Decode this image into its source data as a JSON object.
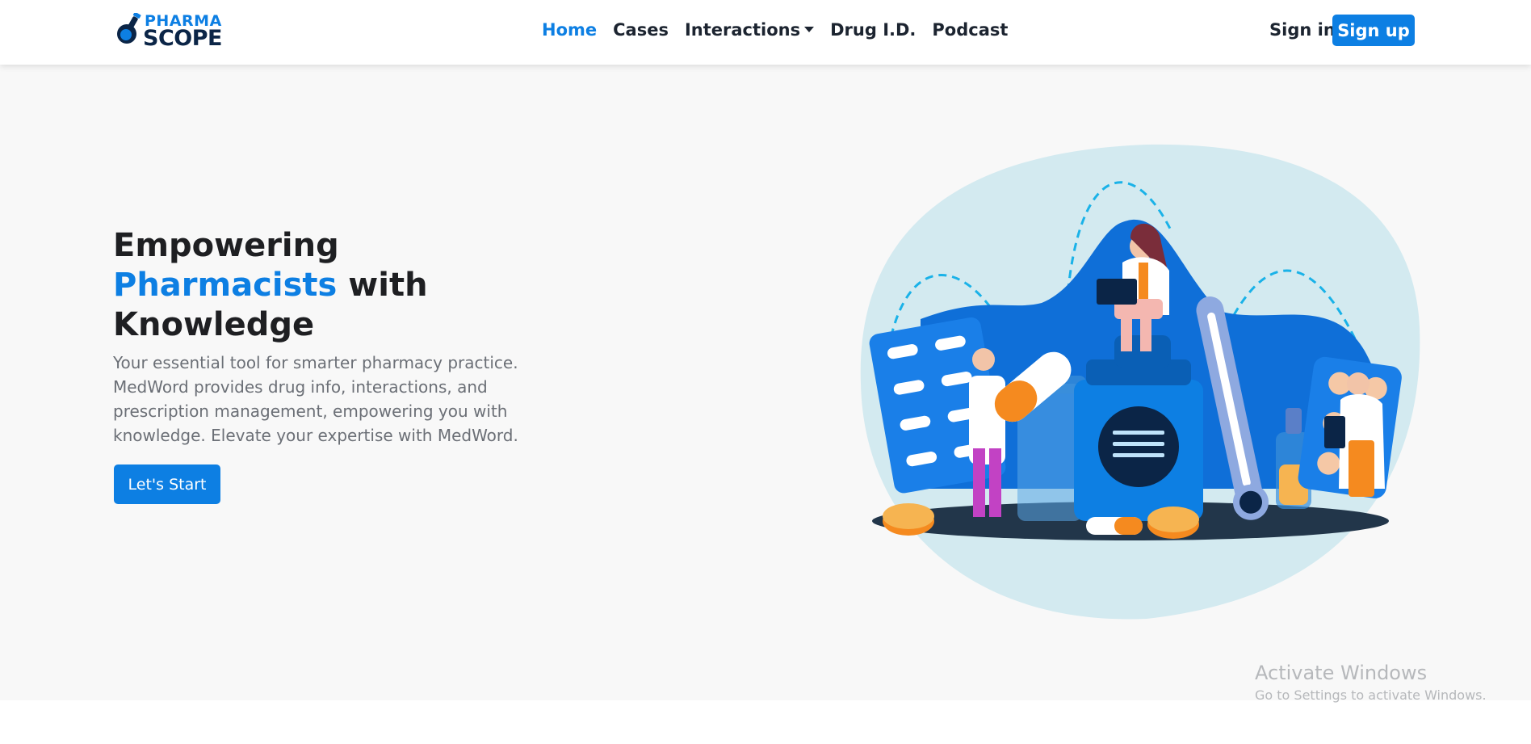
{
  "brand": {
    "logo_top": "PHARMA",
    "logo_bottom": "SCOPE"
  },
  "nav": {
    "items": [
      {
        "label": "Home",
        "active": true
      },
      {
        "label": "Cases"
      },
      {
        "label": "Interactions",
        "dropdown": true
      },
      {
        "label": "Drug I.D."
      },
      {
        "label": "Podcast"
      }
    ],
    "signin_label": "Sign in",
    "signup_label": "Sign up"
  },
  "hero": {
    "headline_part1": "Empowering",
    "headline_highlight": "Pharmacists",
    "headline_part2": "with",
    "headline_part3": "Knowledge",
    "description": "Your essential tool for smarter pharmacy practice. MedWord provides drug info, interactions, and prescription management, empowering you with knowledge. Elevate your expertise with MedWord.",
    "cta_label": "Let's Start"
  },
  "watermark": {
    "title": "Activate Windows",
    "subtitle": "Go to Settings to activate Windows."
  },
  "colors": {
    "accent": "#0d7fe3",
    "dark": "#1c2430",
    "hero_bg": "#f8f8f8",
    "illustration_bg": "#d3eaf0",
    "orange": "#f58a1f"
  }
}
